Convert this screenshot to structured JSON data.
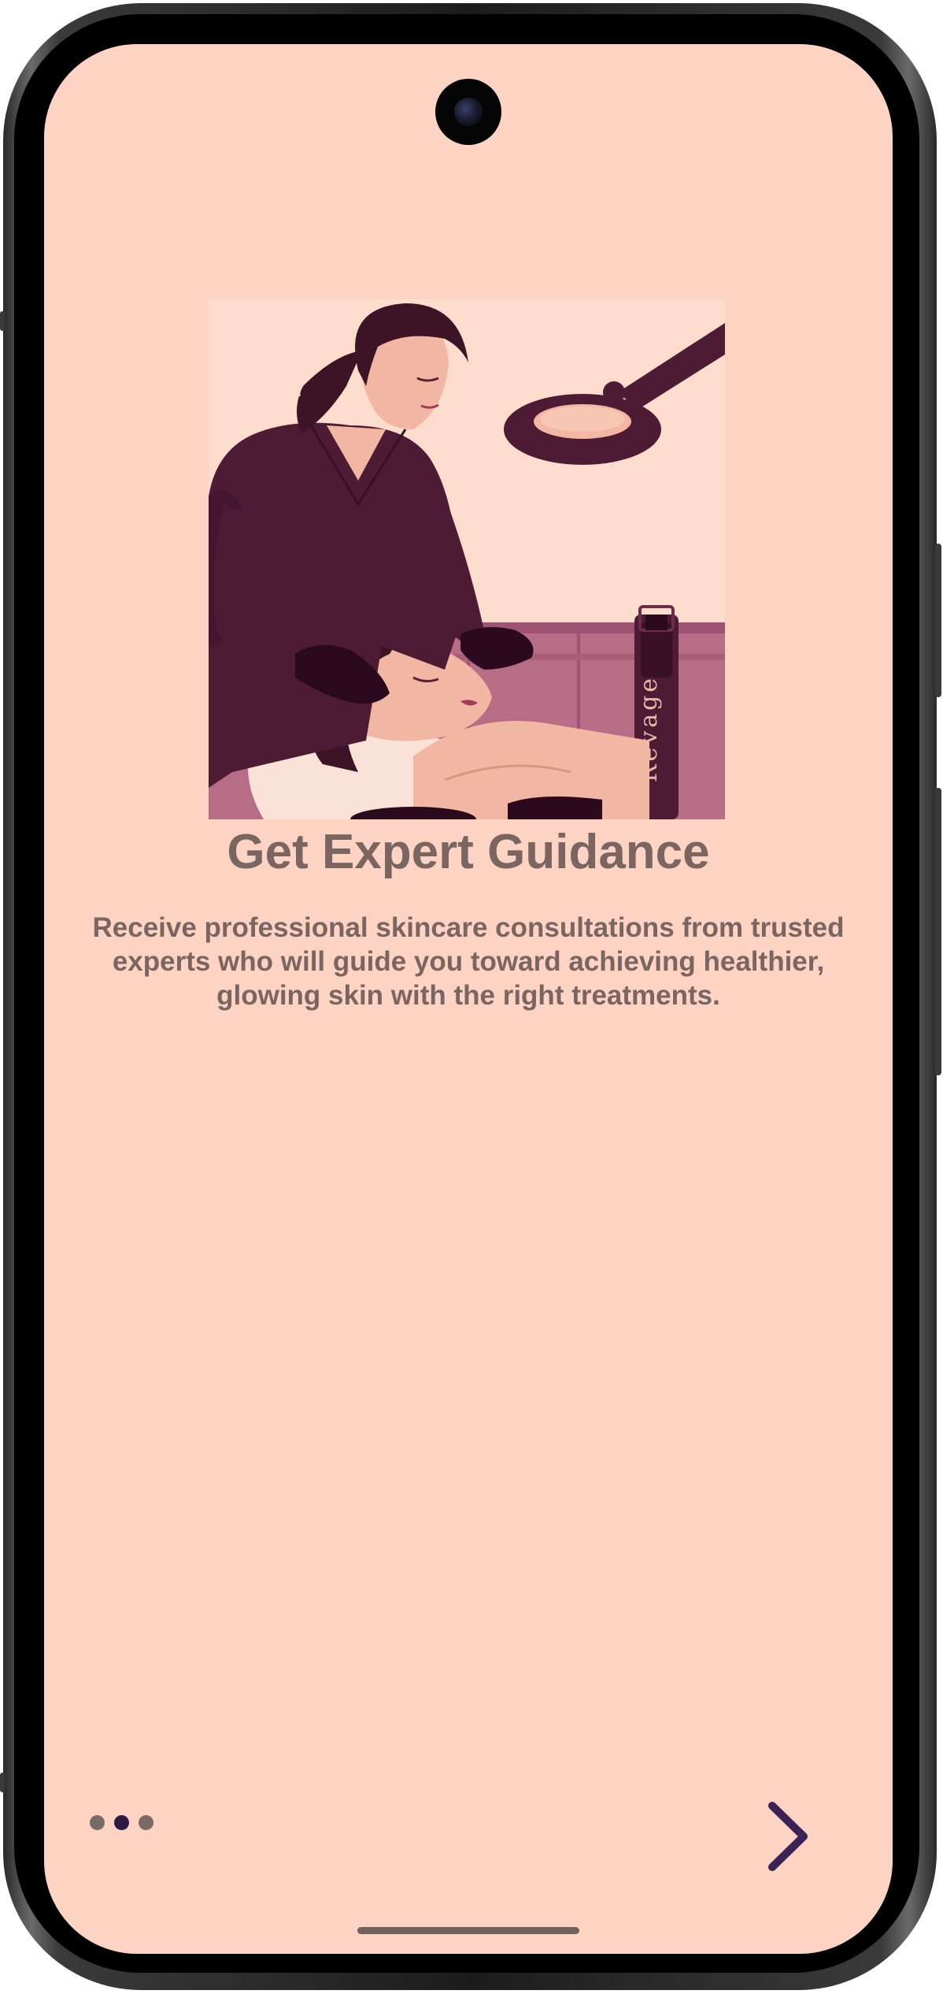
{
  "onboarding": {
    "title": "Get Expert Guidance",
    "description": "Receive professional skincare consultations from trusted experts who will guide you toward achieving healthier, glowing skin with the right treatments.",
    "illustration": {
      "label": "Revage",
      "subject": "esthetician giving facial treatment"
    },
    "pagination": {
      "total": 3,
      "current": 2
    },
    "next_icon": "chevron-right-icon"
  },
  "colors": {
    "background": "#FDD4C4",
    "text": "#7A6560",
    "accent": "#2E1A47",
    "dot_inactive": "#7A6A66",
    "illustration_dark": "#4E1B35"
  }
}
